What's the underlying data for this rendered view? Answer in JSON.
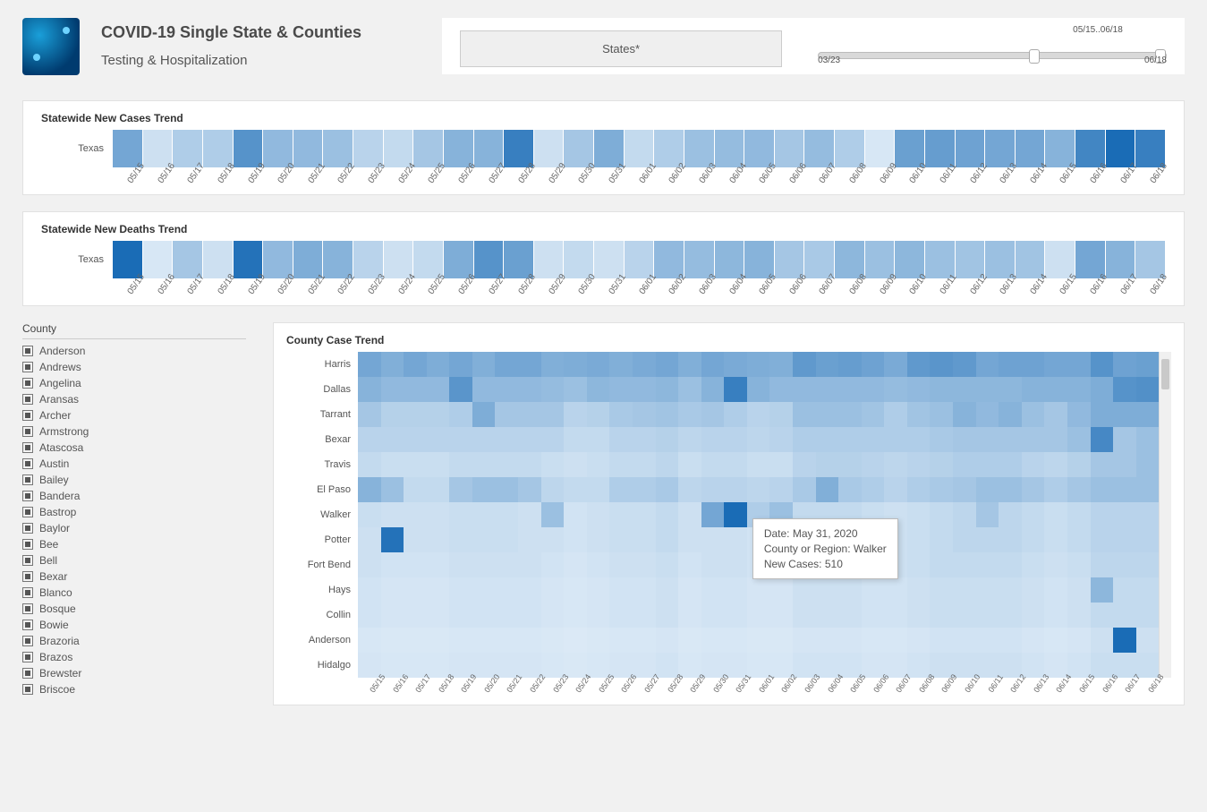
{
  "header": {
    "title": "COVID-19 Single State & Counties",
    "subtitle": "Testing & Hospitalization"
  },
  "controls": {
    "states_button": "States*",
    "slider": {
      "start_label": "03/23",
      "end_label": "06/18",
      "selection_label": "05/15..06/18",
      "handle1_pct": 60.5,
      "handle2_pct": 100
    }
  },
  "dates": [
    "05/15",
    "05/16",
    "05/17",
    "05/18",
    "05/19",
    "05/20",
    "05/21",
    "05/22",
    "05/23",
    "05/24",
    "05/25",
    "05/26",
    "05/27",
    "05/28",
    "05/29",
    "05/30",
    "05/31",
    "06/01",
    "06/02",
    "06/03",
    "06/04",
    "06/05",
    "06/06",
    "06/07",
    "06/08",
    "06/09",
    "06/10",
    "06/11",
    "06/12",
    "06/13",
    "06/14",
    "06/15",
    "06/16",
    "06/17",
    "06/18"
  ],
  "panels": {
    "cases_title": "Statewide New Cases Trend",
    "deaths_title": "Statewide New Deaths Trend",
    "county_title": "County Case Trend",
    "row_label": "Texas"
  },
  "county_filter": {
    "header": "County",
    "items": [
      "Anderson",
      "Andrews",
      "Angelina",
      "Aransas",
      "Archer",
      "Armstrong",
      "Atascosa",
      "Austin",
      "Bailey",
      "Bandera",
      "Bastrop",
      "Baylor",
      "Bee",
      "Bell",
      "Bexar",
      "Blanco",
      "Bosque",
      "Bowie",
      "Brazoria",
      "Brazos",
      "Brewster",
      "Briscoe"
    ]
  },
  "tooltip": {
    "line1": "Date: May 31, 2020",
    "line2": "County or Region: Walker",
    "line3": "New Cases:  510"
  },
  "chart_data": [
    {
      "type": "heatmap",
      "title": "Statewide New Cases Trend",
      "ylabel": "",
      "xlabel": "Date",
      "categories_x": [
        "05/15",
        "05/16",
        "05/17",
        "05/18",
        "05/19",
        "05/20",
        "05/21",
        "05/22",
        "05/23",
        "05/24",
        "05/25",
        "05/26",
        "05/27",
        "05/28",
        "05/29",
        "05/30",
        "05/31",
        "06/01",
        "06/02",
        "06/03",
        "06/04",
        "06/05",
        "06/06",
        "06/07",
        "06/08",
        "06/09",
        "06/10",
        "06/11",
        "06/12",
        "06/13",
        "06/14",
        "06/15",
        "06/16",
        "06/17",
        "06/18"
      ],
      "categories_y": [
        "Texas"
      ],
      "values": [
        [
          55,
          10,
          25,
          25,
          70,
          40,
          40,
          35,
          20,
          15,
          30,
          45,
          45,
          85,
          10,
          30,
          50,
          15,
          25,
          35,
          38,
          40,
          30,
          38,
          25,
          5,
          60,
          62,
          58,
          55,
          55,
          45,
          80,
          100,
          85
        ]
      ],
      "note": "Relative intensities 0-100 inferred from shading; exact case counts not labeled."
    },
    {
      "type": "heatmap",
      "title": "Statewide New Deaths Trend",
      "ylabel": "",
      "xlabel": "Date",
      "categories_x": [
        "05/15",
        "05/16",
        "05/17",
        "05/18",
        "05/19",
        "05/20",
        "05/21",
        "05/22",
        "05/23",
        "05/24",
        "05/25",
        "05/26",
        "05/27",
        "05/28",
        "05/29",
        "05/30",
        "05/31",
        "06/01",
        "06/02",
        "06/03",
        "06/04",
        "06/05",
        "06/06",
        "06/07",
        "06/08",
        "06/09",
        "06/10",
        "06/11",
        "06/12",
        "06/13",
        "06/14",
        "06/15",
        "06/16",
        "06/17",
        "06/18"
      ],
      "categories_y": [
        "Texas"
      ],
      "values": [
        [
          100,
          5,
          30,
          10,
          95,
          40,
          50,
          45,
          20,
          10,
          15,
          50,
          70,
          60,
          10,
          15,
          10,
          20,
          40,
          38,
          42,
          45,
          30,
          28,
          42,
          35,
          42,
          35,
          32,
          35,
          32,
          10,
          55,
          45,
          30
        ]
      ],
      "note": "Relative intensities 0-100 inferred from shading."
    },
    {
      "type": "heatmap",
      "title": "County Case Trend",
      "ylabel": "County",
      "xlabel": "Date",
      "categories_x": [
        "05/15",
        "05/16",
        "05/17",
        "05/18",
        "05/19",
        "05/20",
        "05/21",
        "05/22",
        "05/23",
        "05/24",
        "05/25",
        "05/26",
        "05/27",
        "05/28",
        "05/29",
        "05/30",
        "05/31",
        "06/01",
        "06/02",
        "06/03",
        "06/04",
        "06/05",
        "06/06",
        "06/07",
        "06/08",
        "06/09",
        "06/10",
        "06/11",
        "06/12",
        "06/13",
        "06/14",
        "06/15",
        "06/16",
        "06/17",
        "06/18"
      ],
      "categories_y": [
        "Harris",
        "Dallas",
        "Tarrant",
        "Bexar",
        "Travis",
        "El Paso",
        "Walker",
        "Potter",
        "Fort Bend",
        "Hays",
        "Collin",
        "Anderson",
        "Hidalgo"
      ],
      "values": [
        [
          55,
          48,
          55,
          50,
          55,
          48,
          55,
          55,
          48,
          50,
          52,
          48,
          52,
          55,
          48,
          55,
          52,
          50,
          48,
          65,
          60,
          62,
          58,
          52,
          65,
          68,
          65,
          55,
          58,
          58,
          55,
          55,
          70,
          58,
          60
        ],
        [
          45,
          40,
          40,
          40,
          68,
          40,
          40,
          40,
          38,
          35,
          42,
          40,
          40,
          42,
          35,
          45,
          85,
          45,
          40,
          40,
          40,
          40,
          40,
          38,
          40,
          42,
          42,
          42,
          42,
          45,
          45,
          45,
          50,
          70,
          72
        ],
        [
          30,
          22,
          22,
          22,
          25,
          50,
          30,
          30,
          30,
          20,
          22,
          28,
          30,
          32,
          28,
          30,
          25,
          20,
          22,
          35,
          35,
          35,
          32,
          25,
          32,
          35,
          45,
          40,
          45,
          35,
          30,
          40,
          50,
          50,
          50
        ],
        [
          20,
          20,
          20,
          20,
          20,
          20,
          20,
          20,
          20,
          15,
          15,
          20,
          20,
          22,
          18,
          20,
          20,
          18,
          20,
          25,
          25,
          25,
          25,
          25,
          25,
          28,
          30,
          30,
          30,
          30,
          30,
          35,
          78,
          30,
          35
        ],
        [
          15,
          12,
          12,
          12,
          15,
          15,
          15,
          15,
          12,
          10,
          12,
          15,
          15,
          18,
          12,
          15,
          15,
          12,
          12,
          20,
          22,
          22,
          20,
          18,
          20,
          22,
          25,
          25,
          25,
          20,
          18,
          22,
          30,
          30,
          35
        ],
        [
          45,
          35,
          15,
          15,
          30,
          35,
          35,
          30,
          18,
          15,
          15,
          25,
          25,
          28,
          18,
          20,
          20,
          18,
          20,
          28,
          48,
          28,
          25,
          20,
          25,
          28,
          30,
          35,
          35,
          30,
          25,
          30,
          35,
          35,
          35
        ],
        [
          12,
          10,
          10,
          10,
          12,
          12,
          12,
          10,
          35,
          8,
          10,
          12,
          12,
          15,
          10,
          55,
          100,
          25,
          35,
          15,
          15,
          15,
          12,
          10,
          12,
          15,
          18,
          30,
          18,
          15,
          12,
          15,
          20,
          20,
          20
        ],
        [
          10,
          95,
          10,
          10,
          12,
          12,
          12,
          10,
          10,
          8,
          10,
          12,
          12,
          15,
          10,
          10,
          10,
          8,
          10,
          15,
          15,
          15,
          12,
          10,
          12,
          15,
          18,
          18,
          18,
          15,
          12,
          15,
          20,
          20,
          20
        ],
        [
          10,
          8,
          8,
          8,
          10,
          10,
          10,
          10,
          8,
          6,
          8,
          10,
          10,
          12,
          8,
          10,
          10,
          8,
          8,
          12,
          12,
          12,
          10,
          10,
          12,
          15,
          15,
          15,
          15,
          12,
          10,
          12,
          18,
          18,
          18
        ],
        [
          8,
          6,
          6,
          6,
          8,
          8,
          8,
          8,
          6,
          5,
          6,
          8,
          8,
          10,
          6,
          8,
          8,
          6,
          6,
          10,
          10,
          10,
          8,
          8,
          10,
          12,
          12,
          12,
          12,
          10,
          8,
          10,
          42,
          15,
          15
        ],
        [
          8,
          6,
          6,
          6,
          8,
          8,
          8,
          8,
          6,
          5,
          6,
          8,
          8,
          10,
          6,
          8,
          8,
          6,
          6,
          10,
          10,
          10,
          8,
          8,
          10,
          12,
          12,
          12,
          12,
          10,
          8,
          10,
          15,
          15,
          15
        ],
        [
          5,
          4,
          4,
          4,
          5,
          5,
          5,
          5,
          4,
          3,
          4,
          5,
          5,
          6,
          4,
          5,
          5,
          4,
          4,
          6,
          6,
          6,
          5,
          5,
          6,
          8,
          8,
          8,
          8,
          6,
          5,
          6,
          10,
          100,
          10
        ],
        [
          6,
          5,
          5,
          5,
          6,
          6,
          6,
          6,
          5,
          4,
          5,
          6,
          6,
          8,
          5,
          6,
          6,
          5,
          5,
          8,
          8,
          8,
          6,
          6,
          8,
          10,
          10,
          10,
          10,
          8,
          6,
          8,
          12,
          12,
          12
        ]
      ],
      "note": "Relative intensities 0-100 per cell inferred from shading. Tooltip shows Walker on 05/31 = 510 new cases (actual data point)."
    }
  ]
}
